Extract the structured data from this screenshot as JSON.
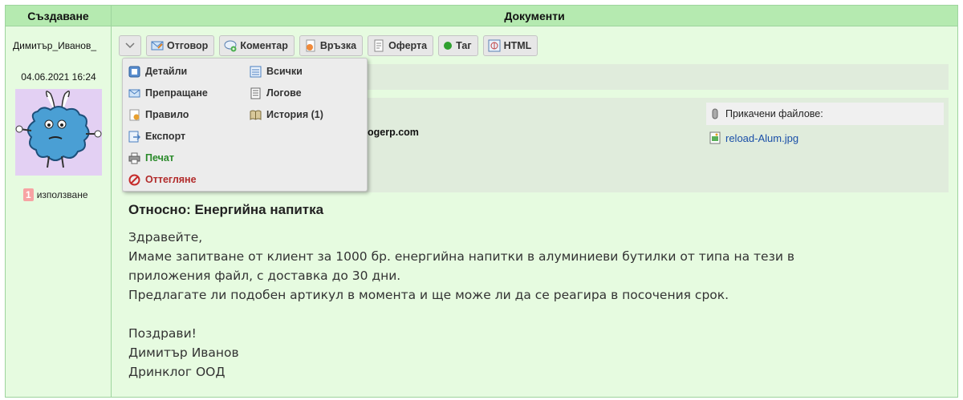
{
  "headers": {
    "create": "Създаване",
    "documents": "Документи"
  },
  "author": {
    "name": "Димитър_Иванов_",
    "date": "04.06.2021 16:24",
    "usage_count": "1",
    "usage_label": "използване"
  },
  "toolbar": {
    "reply": "Отговор",
    "comment": "Коментар",
    "link": "Връзка",
    "offer": "Оферта",
    "tag": "Таг",
    "html": "HTML"
  },
  "menu": {
    "details": "Детайли",
    "all": "Всички",
    "forward": "Препращане",
    "logs": "Логове",
    "rule": "Правило",
    "history": "История (1)",
    "export": "Експорт",
    "print": "Печат",
    "reject": "Оттегляне"
  },
  "email_fragment": "ogerp.com",
  "attachments": {
    "label": "Прикачени файлове:",
    "file": "reload-Alum.jpg"
  },
  "message": {
    "subject": "Относно: Енергийна напитка",
    "lines": [
      "Здравейте,",
      "Имаме запитване от клиент за 1000 бр. енергийна напитки в алуминиеви бутилки от типа на тези в",
      "приложения файл, с доставка до 30 дни.",
      "Предлагате ли подобен артикул в момента и ще може ли да се реагира в посочения срок.",
      "",
      "Поздрави!",
      "Димитър Иванов",
      "Дринклог ООД"
    ]
  },
  "colors": {
    "header_bg": "#b5eab0",
    "panel_bg": "#e6fbe0",
    "border": "#9dd49d",
    "link": "#1a4fa8",
    "print_green": "#2a8a2a",
    "reject_red": "#b22b2b"
  }
}
